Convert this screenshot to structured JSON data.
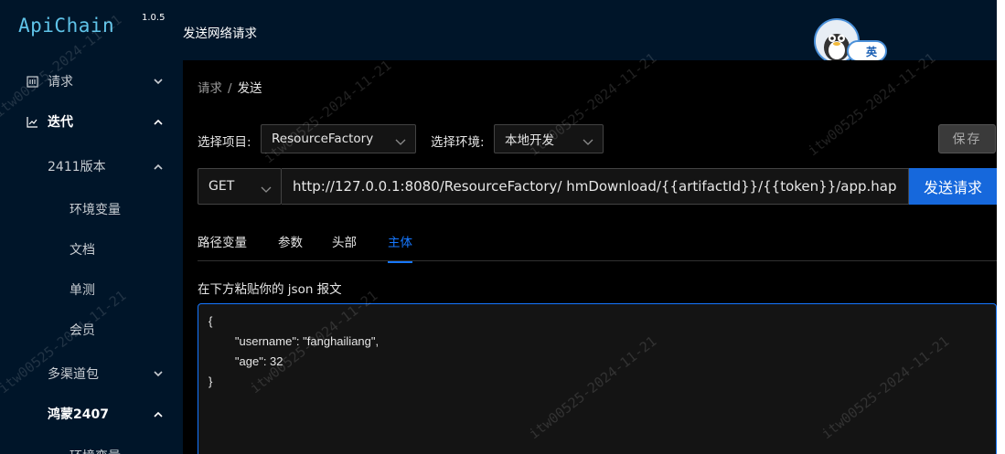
{
  "app": {
    "name": "ApiChain",
    "version": "1.0.5"
  },
  "header": {
    "title": "发送网络请求",
    "lang_label": "英"
  },
  "sidebar": {
    "items": [
      {
        "label": "请求",
        "icon": "request-icon",
        "expanded": false
      },
      {
        "label": "迭代",
        "icon": "chart-icon",
        "expanded": true
      },
      {
        "label": "2411版本",
        "expanded": true
      },
      {
        "label": "环境变量"
      },
      {
        "label": "文档"
      },
      {
        "label": "单测"
      },
      {
        "label": "会员"
      },
      {
        "label": "多渠道包",
        "expanded": false
      },
      {
        "label": "鸿蒙2407",
        "expanded": true
      },
      {
        "label": "环境变量"
      }
    ]
  },
  "breadcrumb": {
    "parent": "请求",
    "separator": "/",
    "current": "发送"
  },
  "project": {
    "label": "选择项目:",
    "value": "ResourceFactory"
  },
  "environment": {
    "label": "选择环境:",
    "value": "本地开发"
  },
  "save_label": "保存",
  "request": {
    "method": "GET",
    "url": "http://127.0.0.1:8080/ResourceFactory/ hmDownload/{{artifactId}}/{{token}}/app.hap",
    "send_label": "发送请求"
  },
  "tabs": [
    {
      "label": "路径变量"
    },
    {
      "label": "参数"
    },
    {
      "label": "头部"
    },
    {
      "label": "主体",
      "active": true
    }
  ],
  "body": {
    "hint": "在下方粘贴你的 json 报文",
    "json_text": "{\n        \"username\": \"fanghailiang\",\n        \"age\": 32\n}"
  },
  "watermark_text": "itw00525-2024-11-21",
  "colors": {
    "accent": "#1677ff",
    "sidebar": "#001529",
    "logo": "#5fc3e8"
  }
}
